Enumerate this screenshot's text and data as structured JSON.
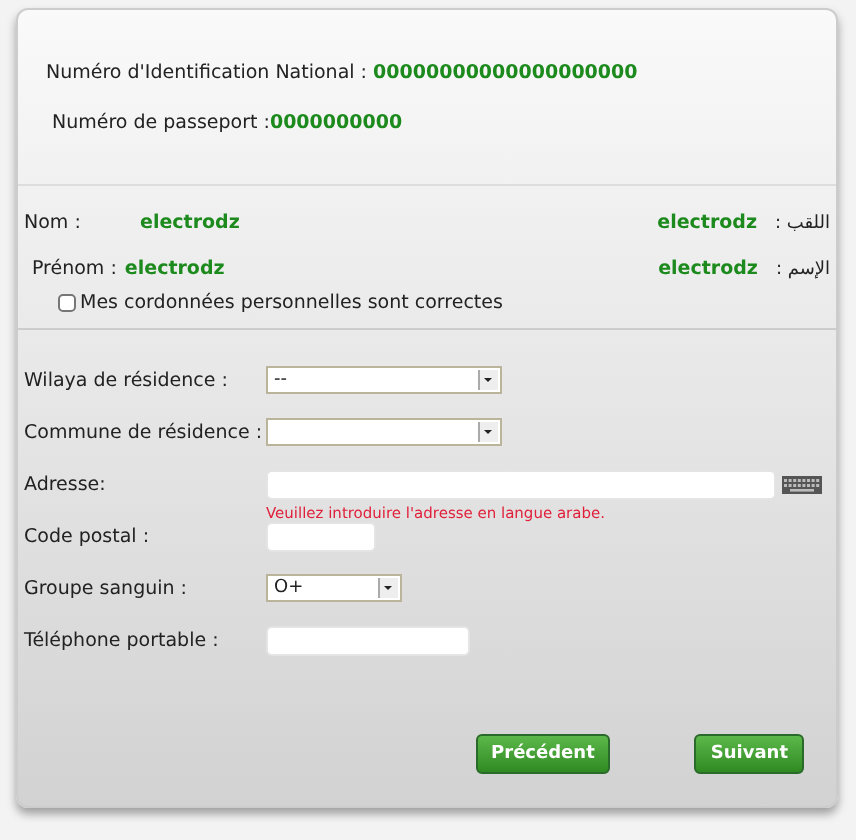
{
  "identity": {
    "nin_label": "Numéro d'Identification National :",
    "nin_value": "00000000000000000000",
    "passport_label": "Numéro de passeport :",
    "passport_value": "0000000000"
  },
  "names": [
    {
      "label": "Nom :",
      "value": "electrodz",
      "ar_value": "electrodz",
      "ar_label": "اللقب :"
    },
    {
      "label": "Prénom :",
      "value": "electrodz",
      "ar_value": "electrodz",
      "ar_label": "الإسم :"
    }
  ],
  "confirm": {
    "label": "Mes cordonnées personnelles sont correctes",
    "checked": false
  },
  "fields": [
    {
      "kind": "select",
      "label": "Wilaya de résidence :",
      "value": "--"
    },
    {
      "kind": "select",
      "label": "Commune de résidence :"
    },
    {
      "kind": "text",
      "label": "Adresse:",
      "keyboard": true,
      "hint": "Veuillez introduire l'adresse en langue arabe."
    },
    {
      "kind": "text",
      "label": "Code postal :"
    },
    {
      "kind": "select",
      "label": "Groupe sanguin :",
      "value": "O+"
    },
    {
      "kind": "text",
      "label": "Téléphone portable :"
    }
  ],
  "buttons": [
    {
      "label": "Précédent"
    },
    {
      "label": "Suivant"
    }
  ]
}
